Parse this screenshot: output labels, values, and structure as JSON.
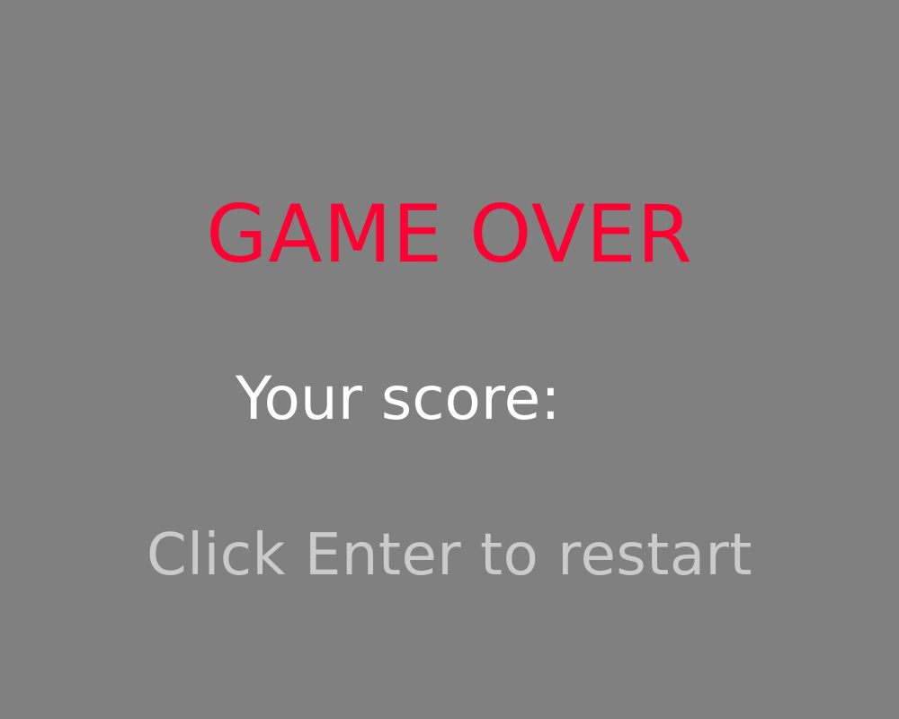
{
  "screen": {
    "title": "GAME OVER",
    "score_label": "Your score:",
    "score_value": "",
    "restart_hint": "Click Enter to restart"
  },
  "colors": {
    "background": "#808080",
    "title": "#ff0033",
    "score": "#ffffff",
    "hint": "#cbcbcb"
  }
}
